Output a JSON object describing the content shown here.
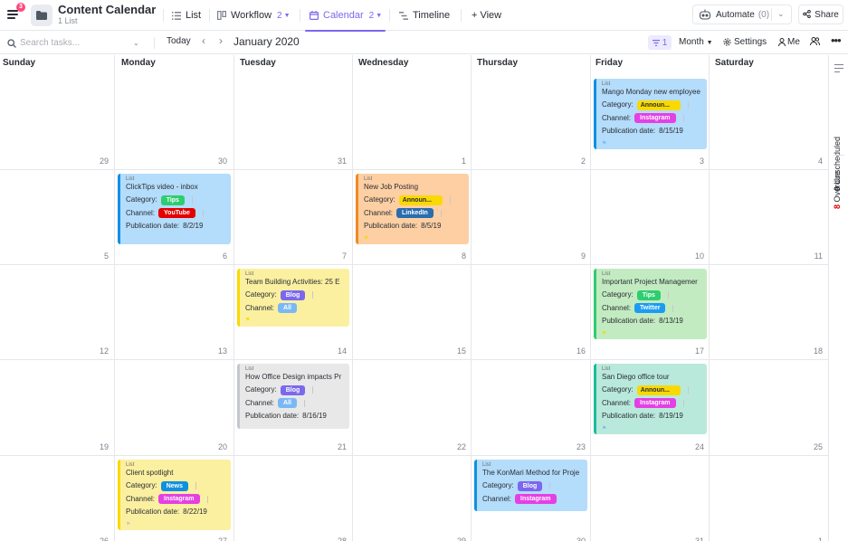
{
  "header": {
    "title": "Content Calendar",
    "subtitle": "1 List",
    "menu_badge": "3",
    "views": [
      {
        "label": "List",
        "icon": "list-icon"
      },
      {
        "label": "Workflow",
        "count": "2",
        "icon": "board-icon"
      },
      {
        "label": "Calendar",
        "count": "2",
        "icon": "calendar-icon",
        "active": true
      },
      {
        "label": "Timeline",
        "icon": "timeline-icon"
      }
    ],
    "add_view_label": "+ View",
    "automate_label": "Automate",
    "automate_count": "(0)",
    "share_label": "Share"
  },
  "toolbar": {
    "search_placeholder": "Search tasks...",
    "today_label": "Today",
    "month_label": "January 2020",
    "filter_count": "1",
    "view_mode_label": "Month",
    "settings_label": "Settings",
    "me_label": "Me"
  },
  "calendar": {
    "weekdays": [
      "Sunday",
      "Monday",
      "Tuesday",
      "Wednesday",
      "Thursday",
      "Friday",
      "Saturday"
    ],
    "weeks": [
      [
        "29",
        "30",
        "31",
        "1",
        "2",
        "3",
        "4"
      ],
      [
        "5",
        "6",
        "7",
        "8",
        "9",
        "10",
        "11"
      ],
      [
        "12",
        "13",
        "14",
        "15",
        "16",
        "17",
        "18"
      ],
      [
        "19",
        "20",
        "21",
        "22",
        "23",
        "24",
        "25"
      ],
      [
        "26",
        "27",
        "28",
        "29",
        "30",
        "31",
        "1"
      ]
    ]
  },
  "labels": {
    "list": "List",
    "category": "Category:",
    "channel": "Channel:",
    "publication_date": "Publication date:"
  },
  "colors": {
    "accent": "#7b68ee",
    "tips": "#2ecd6f",
    "announcement": "#f9d900",
    "blog": "#7b68ee",
    "news": "#1090e0",
    "youtube": "#e50000",
    "linkedin": "#2a6cb0",
    "instagram": "#e440e4",
    "twitter": "#1b9cf2",
    "all": "#7ab8f5"
  },
  "cards": [
    {
      "title": "Mango Monday new employee",
      "category": "Announ...",
      "channel": "Instagram",
      "date": "8/15/19"
    },
    {
      "title": "ClickTips video - inbox",
      "category": "Tips",
      "channel": "YouTube",
      "date": "8/2/19"
    },
    {
      "title": "New Job Posting",
      "category": "Announ...",
      "channel": "LinkedIn",
      "date": "8/5/19"
    },
    {
      "title": "Team Building Activities: 25 E",
      "category": "Blog",
      "channel": "All"
    },
    {
      "title": "Important Project Managemer",
      "category": "Tips",
      "channel": "Twitter",
      "date": "8/13/19"
    },
    {
      "title": "How Office Design impacts Pr",
      "category": "Blog",
      "channel": "All",
      "date": "8/16/19"
    },
    {
      "title": "San Diego office tour",
      "category": "Announ...",
      "channel": "Instagram",
      "date": "8/19/19"
    },
    {
      "title": "Client spotlight",
      "category": "News",
      "channel": "Instagram",
      "date": "8/22/19"
    },
    {
      "title": "The KonMari Method for Proje",
      "category": "Blog",
      "channel": "Instagram"
    }
  ],
  "rail": {
    "unscheduled_count": "0",
    "unscheduled_label": "Unscheduled",
    "overdue_count": "8",
    "overdue_label": "Overdue"
  }
}
